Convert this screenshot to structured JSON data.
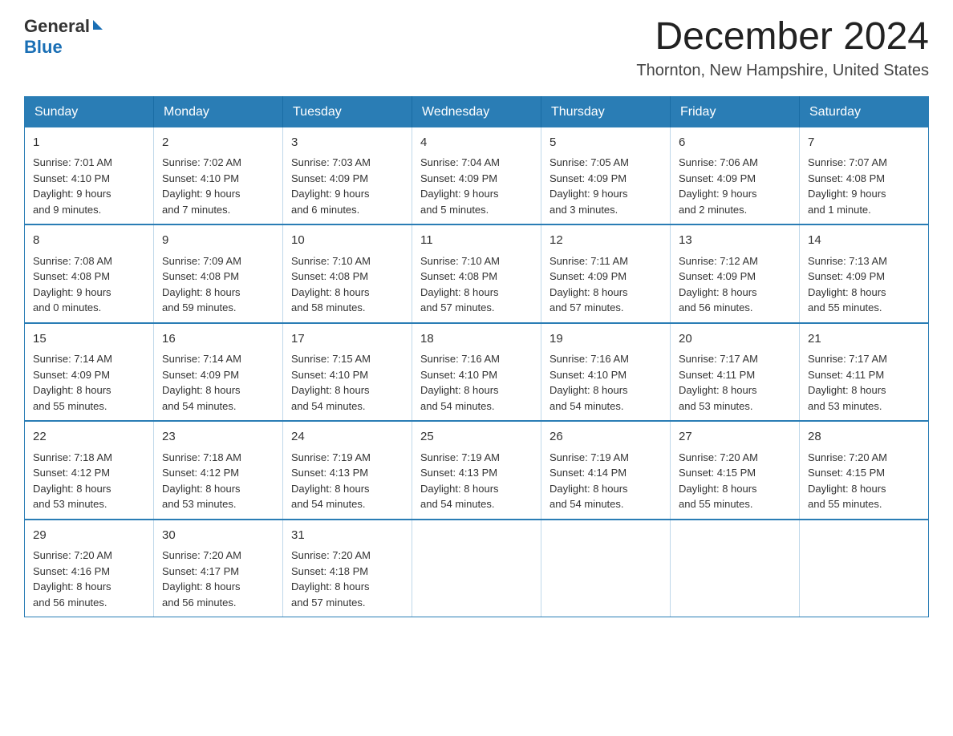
{
  "header": {
    "logo_general": "General",
    "logo_blue": "Blue",
    "month_title": "December 2024",
    "location": "Thornton, New Hampshire, United States"
  },
  "calendar": {
    "days_of_week": [
      "Sunday",
      "Monday",
      "Tuesday",
      "Wednesday",
      "Thursday",
      "Friday",
      "Saturday"
    ],
    "weeks": [
      [
        {
          "day": "1",
          "info": "Sunrise: 7:01 AM\nSunset: 4:10 PM\nDaylight: 9 hours\nand 9 minutes."
        },
        {
          "day": "2",
          "info": "Sunrise: 7:02 AM\nSunset: 4:10 PM\nDaylight: 9 hours\nand 7 minutes."
        },
        {
          "day": "3",
          "info": "Sunrise: 7:03 AM\nSunset: 4:09 PM\nDaylight: 9 hours\nand 6 minutes."
        },
        {
          "day": "4",
          "info": "Sunrise: 7:04 AM\nSunset: 4:09 PM\nDaylight: 9 hours\nand 5 minutes."
        },
        {
          "day": "5",
          "info": "Sunrise: 7:05 AM\nSunset: 4:09 PM\nDaylight: 9 hours\nand 3 minutes."
        },
        {
          "day": "6",
          "info": "Sunrise: 7:06 AM\nSunset: 4:09 PM\nDaylight: 9 hours\nand 2 minutes."
        },
        {
          "day": "7",
          "info": "Sunrise: 7:07 AM\nSunset: 4:08 PM\nDaylight: 9 hours\nand 1 minute."
        }
      ],
      [
        {
          "day": "8",
          "info": "Sunrise: 7:08 AM\nSunset: 4:08 PM\nDaylight: 9 hours\nand 0 minutes."
        },
        {
          "day": "9",
          "info": "Sunrise: 7:09 AM\nSunset: 4:08 PM\nDaylight: 8 hours\nand 59 minutes."
        },
        {
          "day": "10",
          "info": "Sunrise: 7:10 AM\nSunset: 4:08 PM\nDaylight: 8 hours\nand 58 minutes."
        },
        {
          "day": "11",
          "info": "Sunrise: 7:10 AM\nSunset: 4:08 PM\nDaylight: 8 hours\nand 57 minutes."
        },
        {
          "day": "12",
          "info": "Sunrise: 7:11 AM\nSunset: 4:09 PM\nDaylight: 8 hours\nand 57 minutes."
        },
        {
          "day": "13",
          "info": "Sunrise: 7:12 AM\nSunset: 4:09 PM\nDaylight: 8 hours\nand 56 minutes."
        },
        {
          "day": "14",
          "info": "Sunrise: 7:13 AM\nSunset: 4:09 PM\nDaylight: 8 hours\nand 55 minutes."
        }
      ],
      [
        {
          "day": "15",
          "info": "Sunrise: 7:14 AM\nSunset: 4:09 PM\nDaylight: 8 hours\nand 55 minutes."
        },
        {
          "day": "16",
          "info": "Sunrise: 7:14 AM\nSunset: 4:09 PM\nDaylight: 8 hours\nand 54 minutes."
        },
        {
          "day": "17",
          "info": "Sunrise: 7:15 AM\nSunset: 4:10 PM\nDaylight: 8 hours\nand 54 minutes."
        },
        {
          "day": "18",
          "info": "Sunrise: 7:16 AM\nSunset: 4:10 PM\nDaylight: 8 hours\nand 54 minutes."
        },
        {
          "day": "19",
          "info": "Sunrise: 7:16 AM\nSunset: 4:10 PM\nDaylight: 8 hours\nand 54 minutes."
        },
        {
          "day": "20",
          "info": "Sunrise: 7:17 AM\nSunset: 4:11 PM\nDaylight: 8 hours\nand 53 minutes."
        },
        {
          "day": "21",
          "info": "Sunrise: 7:17 AM\nSunset: 4:11 PM\nDaylight: 8 hours\nand 53 minutes."
        }
      ],
      [
        {
          "day": "22",
          "info": "Sunrise: 7:18 AM\nSunset: 4:12 PM\nDaylight: 8 hours\nand 53 minutes."
        },
        {
          "day": "23",
          "info": "Sunrise: 7:18 AM\nSunset: 4:12 PM\nDaylight: 8 hours\nand 53 minutes."
        },
        {
          "day": "24",
          "info": "Sunrise: 7:19 AM\nSunset: 4:13 PM\nDaylight: 8 hours\nand 54 minutes."
        },
        {
          "day": "25",
          "info": "Sunrise: 7:19 AM\nSunset: 4:13 PM\nDaylight: 8 hours\nand 54 minutes."
        },
        {
          "day": "26",
          "info": "Sunrise: 7:19 AM\nSunset: 4:14 PM\nDaylight: 8 hours\nand 54 minutes."
        },
        {
          "day": "27",
          "info": "Sunrise: 7:20 AM\nSunset: 4:15 PM\nDaylight: 8 hours\nand 55 minutes."
        },
        {
          "day": "28",
          "info": "Sunrise: 7:20 AM\nSunset: 4:15 PM\nDaylight: 8 hours\nand 55 minutes."
        }
      ],
      [
        {
          "day": "29",
          "info": "Sunrise: 7:20 AM\nSunset: 4:16 PM\nDaylight: 8 hours\nand 56 minutes."
        },
        {
          "day": "30",
          "info": "Sunrise: 7:20 AM\nSunset: 4:17 PM\nDaylight: 8 hours\nand 56 minutes."
        },
        {
          "day": "31",
          "info": "Sunrise: 7:20 AM\nSunset: 4:18 PM\nDaylight: 8 hours\nand 57 minutes."
        },
        null,
        null,
        null,
        null
      ]
    ]
  }
}
